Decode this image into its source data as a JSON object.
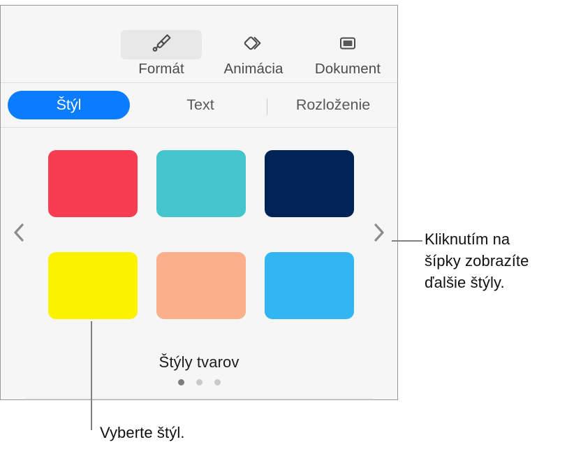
{
  "panel": {
    "toolbar": {
      "items": [
        {
          "label": "Formát",
          "icon": "paintbrush-icon",
          "selected": true
        },
        {
          "label": "Animácia",
          "icon": "animation-diamonds-icon",
          "selected": false
        },
        {
          "label": "Dokument",
          "icon": "document-rectangle-icon",
          "selected": false
        }
      ]
    },
    "tabs": [
      {
        "label": "Štýl",
        "active": true
      },
      {
        "label": "Text",
        "active": false
      },
      {
        "label": "Rozloženie",
        "active": false
      }
    ],
    "swatches": [
      {
        "name": "red",
        "color": "#f73d52"
      },
      {
        "name": "teal",
        "color": "#45c6cc"
      },
      {
        "name": "navy",
        "color": "#022356"
      },
      {
        "name": "yellow",
        "color": "#fbf200"
      },
      {
        "name": "peach",
        "color": "#fbaf8a"
      },
      {
        "name": "light-blue",
        "color": "#32b6f2"
      }
    ],
    "prev_arrow": "chevron-left-icon",
    "next_arrow": "chevron-right-icon",
    "grid_title": "Štýly tvarov",
    "page_dots": {
      "count": 3,
      "active_index": 0
    }
  },
  "callouts": {
    "arrows": "Kliknutím na\nšípky zobrazíte\nďalšie štýly.",
    "style": "Vyberte štýl."
  },
  "colors": {
    "accent": "#0a7cff",
    "panel_bg": "#f6f6f6",
    "panel_border": "#9a9a9a",
    "callout_line": "#808080",
    "text": "#111111"
  }
}
